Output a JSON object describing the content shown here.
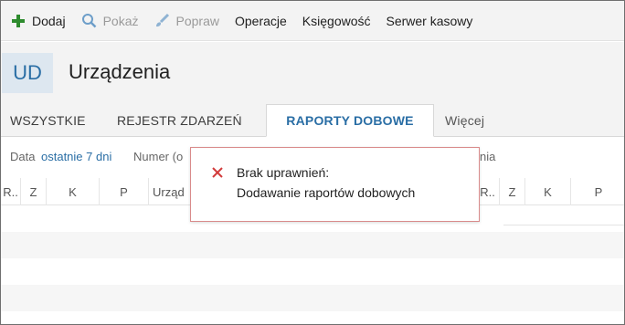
{
  "toolbar": {
    "add_label": "Dodaj",
    "show_label": "Pokaż",
    "edit_label": "Popraw",
    "operations_label": "Operacje",
    "accounting_label": "Księgowość",
    "cash_server_label": "Serwer kasowy",
    "icons": {
      "add": "plus-icon",
      "show": "magnifier-icon",
      "edit": "brush-icon"
    },
    "colors": {
      "add_icon": "#2e8b2e",
      "disabled": "#9a9a9a"
    }
  },
  "header": {
    "badge": "UD",
    "title": "Urządzenia"
  },
  "tabs": [
    {
      "label": "WSZYSTKIE"
    },
    {
      "label": "REJESTR ZDARZEŃ"
    },
    {
      "label": "RAPORTY DOBOWE",
      "active": true
    },
    {
      "label": "Więcej"
    }
  ],
  "filters": {
    "date_label": "Data",
    "date_value": "ostatnie 7 dni",
    "number_label": "Numer (o",
    "partial_right": "nia"
  },
  "grid": {
    "left_columns": [
      "R..",
      "Z",
      "K",
      "P",
      "Urząd"
    ],
    "right_columns": [
      "R..",
      "Z",
      "K",
      "P"
    ]
  },
  "error": {
    "title": "Brak uprawnień:",
    "message": "Dodawanie raportów dobowych",
    "icon": "close-x-icon",
    "color": "#d23c3c"
  },
  "colors": {
    "accent": "#2a6ea5",
    "toolbar_bg": "#f3f3f3"
  }
}
